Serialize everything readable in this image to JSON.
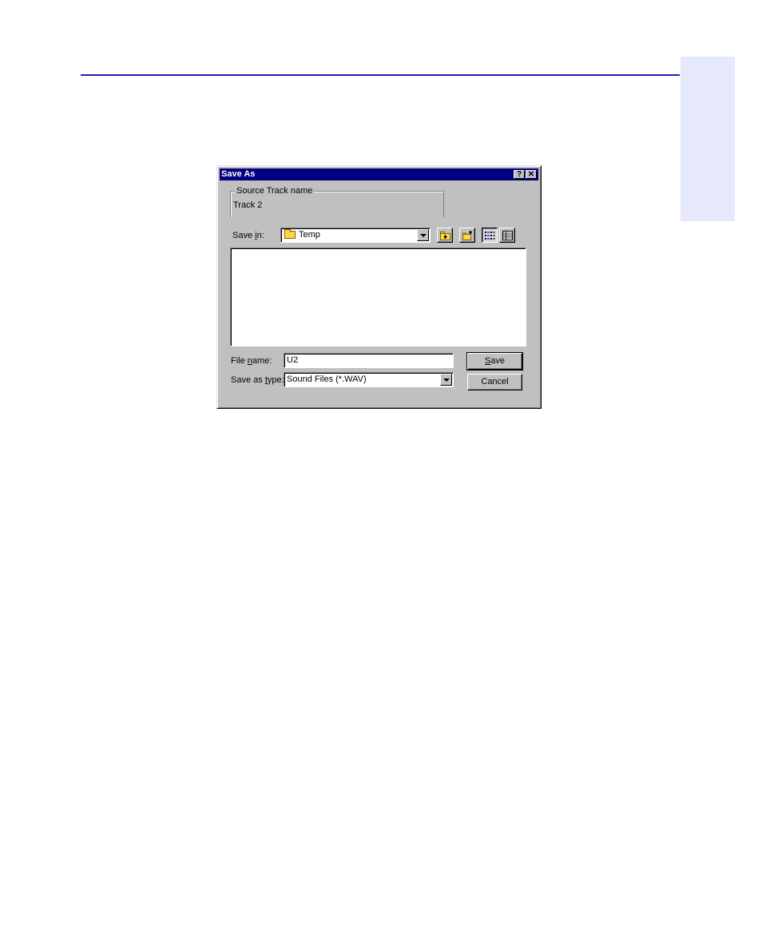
{
  "dialog": {
    "title": "Save As",
    "help_glyph": "?",
    "close_glyph": "✕"
  },
  "source_track": {
    "legend": "Source Track name",
    "value": "Track 2"
  },
  "save_in": {
    "label_pre": "Save ",
    "label_accel": "i",
    "label_post": "n:",
    "folder_icon": "folder-icon",
    "value": "Temp"
  },
  "toolbar": {
    "icons": [
      "up-one-level-icon",
      "create-new-folder-icon",
      "list-view-icon",
      "details-view-icon"
    ],
    "active_view": "list"
  },
  "file_name": {
    "label_pre": "File ",
    "label_accel": "n",
    "label_post": "ame:",
    "value": "U2"
  },
  "save_as_type": {
    "label_pre": "Save as ",
    "label_accel": "t",
    "label_post": "ype:",
    "value": "Sound Files (*.WAV)"
  },
  "buttons": {
    "save_accel": "S",
    "save_rest": "ave",
    "cancel": "Cancel"
  },
  "colors": {
    "title_bar": "#000080",
    "dialog_face": "#c0c0c0",
    "page_rule": "#1f1fb4",
    "side_tab": "#e6e8fb"
  }
}
